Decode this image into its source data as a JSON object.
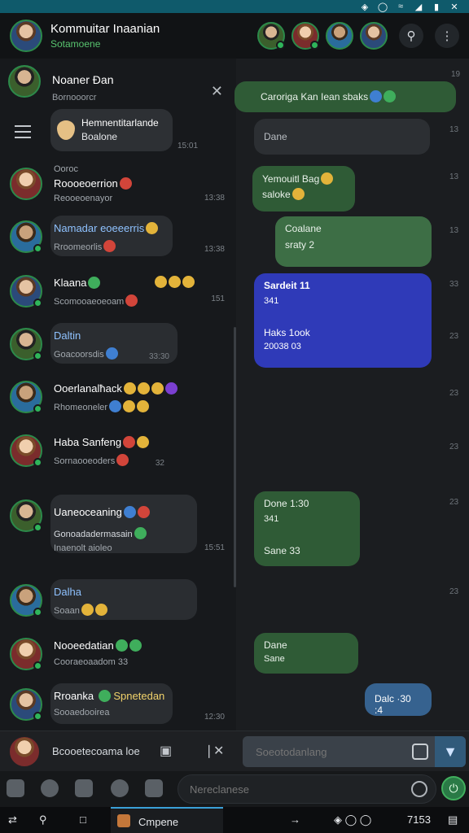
{
  "header": {
    "title": "Kommuitar Inaanian",
    "subtitle": "Sotamoene"
  },
  "left": {
    "top_chat": {
      "name": "Noaner Ðan",
      "sub": "Bornooorcr"
    },
    "pinned": {
      "line1": "Hemnentitarlande",
      "line2": "Boalone",
      "time": "15:01"
    },
    "rows": [
      {
        "name": "Roooeoerrion",
        "pre": "Ooroc",
        "sub": "Reooeoenayor",
        "time": "13:38"
      },
      {
        "name": "Namadar eoeeerris",
        "sub": "Rroomeorlis",
        "time": "13:38"
      },
      {
        "name": "Klaana",
        "sub": "Scomooaeoeoam",
        "time": "151"
      },
      {
        "name": "Daltin",
        "sub": "Goacoorsdis",
        "time": "33:30"
      },
      {
        "name": "Ooerlanalħack",
        "sub": "Rhomeoneler",
        "time": ""
      },
      {
        "name": "Haba Sanfeng",
        "sub": "Sornaooeoders",
        "time": "32"
      },
      {
        "name": "Uaneoceaning",
        "sub": "Gonoadadermasain",
        "sub2": "Inaenolt aioleo",
        "time": "15:51"
      },
      {
        "name": "Dalha",
        "sub": "Soaan",
        "time": ""
      },
      {
        "name": "Nooeedatian",
        "sub": "Cooraeoaadom",
        "time": "33"
      },
      {
        "name": "Rroanka",
        "sub2name": "Spnetedan",
        "sub": "Sooaedooirea",
        "time": "12:30"
      }
    ]
  },
  "messages": {
    "m1": "Caroriga Kan Iean sbaks",
    "m2": "Dane",
    "m3_l1": "Yemouitl Bag",
    "m3_l2": "saloke",
    "m4_l1": "Coalane",
    "m4_l2": "sraty 2",
    "m5_l1": "Sardeit 11",
    "m5_l2": "341",
    "m5_l3": "Haks 1ook",
    "m5_l4": "20038 03",
    "m6_l1": "Done 1:30",
    "m6_l2": "341",
    "m6_l3": "Sane 33",
    "m7_l1": "Dane",
    "m7_l2": "Sane",
    "m8": "Dalc ·30 :4",
    "times": [
      "19",
      "13",
      "13",
      "13",
      "33",
      "23",
      "23",
      "23",
      "23",
      "23"
    ]
  },
  "input": {
    "label": "Bcooetecoama loe",
    "placeholder": "Soeotodanlang"
  },
  "toolbar": {
    "search_placeholder": "Nereclanese"
  },
  "taskbar": {
    "active_label": "Cmpene",
    "tray": "7153"
  }
}
